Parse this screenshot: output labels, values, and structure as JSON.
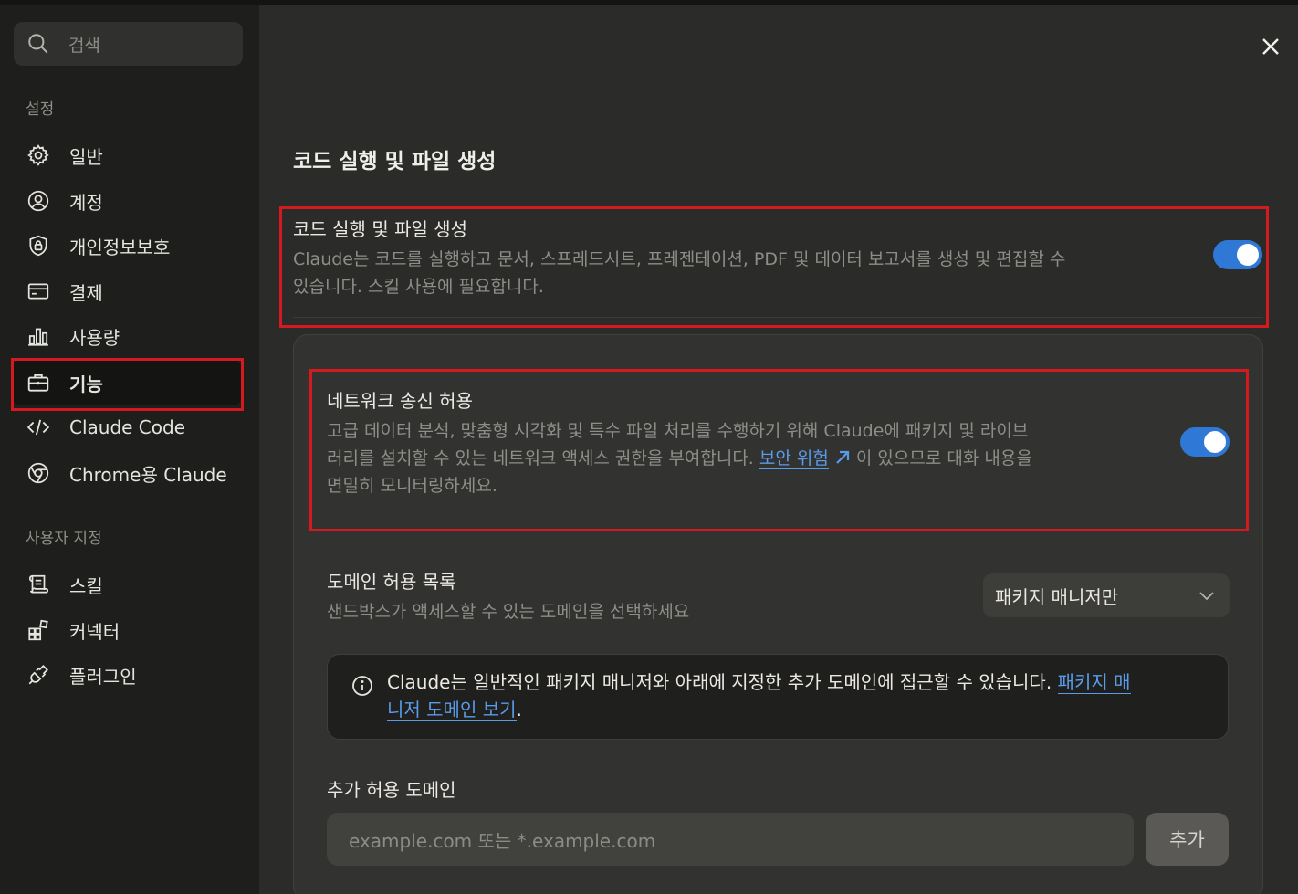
{
  "search": {
    "placeholder": "검색"
  },
  "sidebar": {
    "section_settings": "설정",
    "items": [
      {
        "label": "일반",
        "icon": "gear-icon"
      },
      {
        "label": "계정",
        "icon": "user-circle-icon"
      },
      {
        "label": "개인정보보호",
        "icon": "shield-lock-icon"
      },
      {
        "label": "결제",
        "icon": "credit-card-icon"
      },
      {
        "label": "사용량",
        "icon": "bar-chart-icon"
      },
      {
        "label": "기능",
        "icon": "briefcase-icon"
      },
      {
        "label": "Claude Code",
        "icon": "code-icon"
      },
      {
        "label": "Chrome용 Claude",
        "icon": "chrome-icon"
      }
    ],
    "section_custom": "사용자 지정",
    "custom_items": [
      {
        "label": "스킬",
        "icon": "scroll-icon"
      },
      {
        "label": "커넥터",
        "icon": "blocks-icon"
      },
      {
        "label": "플러그인",
        "icon": "plug-icon"
      }
    ]
  },
  "main": {
    "page_title": "코드 실행 및 파일 생성",
    "code_exec": {
      "title": "코드 실행 및 파일 생성",
      "desc_line1": "Claude는 코드를 실행하고 문서, 스프레드시트, 프레젠테이션, PDF 및 데이터 보고서를 생성 및 편집할 수",
      "desc_line2": "있습니다. 스킬 사용에 필요합니다.",
      "enabled": true
    },
    "network": {
      "title": "네트워크 송신 허용",
      "desc_line1": "고급 데이터 분석, 맞춤형 시각화 및 특수 파일 처리를 수행하기 위해 Claude에 패키지 및 라이브",
      "desc_line2_a": "러리를 설치할 수 있는 네트워크 액세스 권한을 부여합니다. ",
      "desc_link": "보안 위험",
      "desc_line2_b": " 이 있으므로 대화 내용을",
      "desc_line3": "면밀히 모니터링하세요.",
      "enabled": true
    },
    "domain_list": {
      "title": "도메인 허용 목록",
      "desc": "샌드박스가 액세스할 수 있는 도메인을 선택하세요",
      "selected": "패키지 매니저만"
    },
    "info": {
      "text": "Claude는 일반적인 패키지 매니저와 아래에 지정한 추가 도메인에 접근할 수 있습니다. ",
      "link_part1": "패키지 매",
      "link_part2": "니저 도메인 보기",
      "period": "."
    },
    "extra_domains": {
      "title": "추가 허용 도메인",
      "placeholder": "example.com 또는 *.example.com",
      "add_label": "추가"
    }
  },
  "colors": {
    "accent": "#2f78d6",
    "link": "#5a9be8",
    "highlight": "#d41a1f"
  }
}
